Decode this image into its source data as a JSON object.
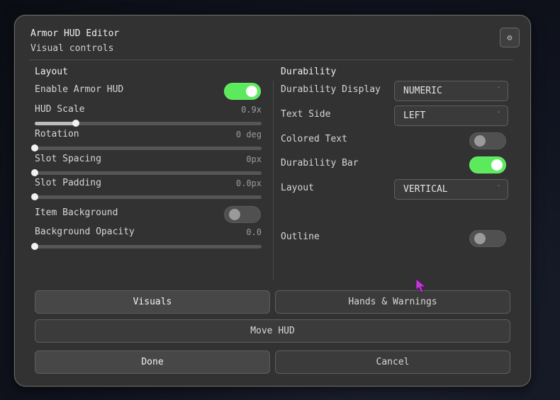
{
  "header": {
    "title": "Armor HUD Editor",
    "subtitle": "Visual controls",
    "settings_icon": "gear-icon"
  },
  "layout_section": {
    "title": "Layout",
    "enable_armor_hud": {
      "label": "Enable Armor HUD",
      "on": true
    },
    "hud_scale": {
      "label": "HUD Scale",
      "value": "0.9x",
      "fraction": 0.18
    },
    "rotation": {
      "label": "Rotation",
      "value": "0 deg",
      "fraction": 0
    },
    "slot_spacing": {
      "label": "Slot Spacing",
      "value": "0px",
      "fraction": 0
    },
    "slot_padding": {
      "label": "Slot Padding",
      "value": "0.0px",
      "fraction": 0
    },
    "item_background": {
      "label": "Item Background",
      "on": false
    },
    "background_opacity": {
      "label": "Background Opacity",
      "value": "0.0",
      "fraction": 0
    }
  },
  "durability_section": {
    "title": "Durability",
    "durability_display": {
      "label": "Durability Display",
      "value": "NUMERIC"
    },
    "text_side": {
      "label": "Text Side",
      "value": "LEFT"
    },
    "colored_text": {
      "label": "Colored Text",
      "on": false
    },
    "durability_bar": {
      "label": "Durability Bar",
      "on": true
    },
    "layout": {
      "label": "Layout",
      "value": "VERTICAL"
    },
    "outline": {
      "label": "Outline",
      "on": false
    }
  },
  "tabs": {
    "visuals": "Visuals",
    "hands_warnings": "Hands & Warnings"
  },
  "actions": {
    "move_hud": "Move HUD",
    "done": "Done",
    "cancel": "Cancel"
  },
  "colors": {
    "toggle_on": "#5bea5b",
    "panel_bg": "#323232",
    "cursor": "#c23bd8"
  }
}
